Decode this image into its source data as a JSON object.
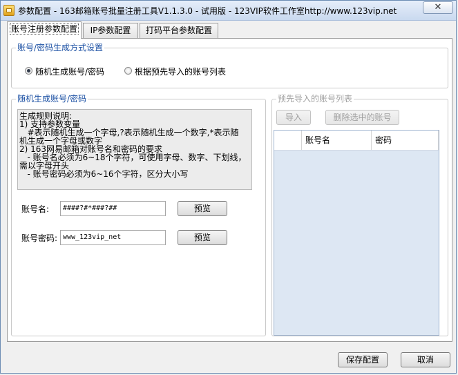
{
  "window": {
    "title": "参数配置 - 163邮箱账号批量注册工具V1.1.3.0 - 试用版 - 123VIP软件工作室http://www.123vip.net",
    "close_label": "✕"
  },
  "tabs": [
    {
      "label": "账号注册参数配置",
      "active": true
    },
    {
      "label": "IP参数配置",
      "active": false
    },
    {
      "label": "打码平台参数配置",
      "active": false
    }
  ],
  "gen_mode": {
    "title": "账号/密码生成方式设置",
    "options": [
      {
        "label": "随机生成账号/密码",
        "selected": true
      },
      {
        "label": "根据预先导入的账号列表",
        "selected": false
      }
    ]
  },
  "random_gen": {
    "title": "随机生成账号/密码",
    "rules_text": "生成规则说明:\n1) 支持参数变量\n   #表示随机生成一个字母,?表示随机生成一个数字,*表示随\n机生成一个字母或数字\n2) 163网易邮箱对账号名和密码的要求\n   - 账号名必须为6~18个字符，可使用字母、数字、下划线，\n需以字母开头\n   - 账号密码必须为6~16个字符，区分大小写",
    "account_label": "账号名:",
    "account_value": "####?#*###?##",
    "password_label": "账号密码:",
    "password_value": "www_123vip_net",
    "preview_label": "预览"
  },
  "import_list": {
    "title": "预先导入的账号列表",
    "import_label": "导入",
    "delete_label": "删除选中的账号",
    "columns": [
      "",
      "账号名",
      "密码"
    ]
  },
  "footer": {
    "save_label": "保存配置",
    "cancel_label": "取消"
  },
  "colors": {
    "group_title": "#1a4fa3",
    "list_background": "#dde7f3"
  }
}
